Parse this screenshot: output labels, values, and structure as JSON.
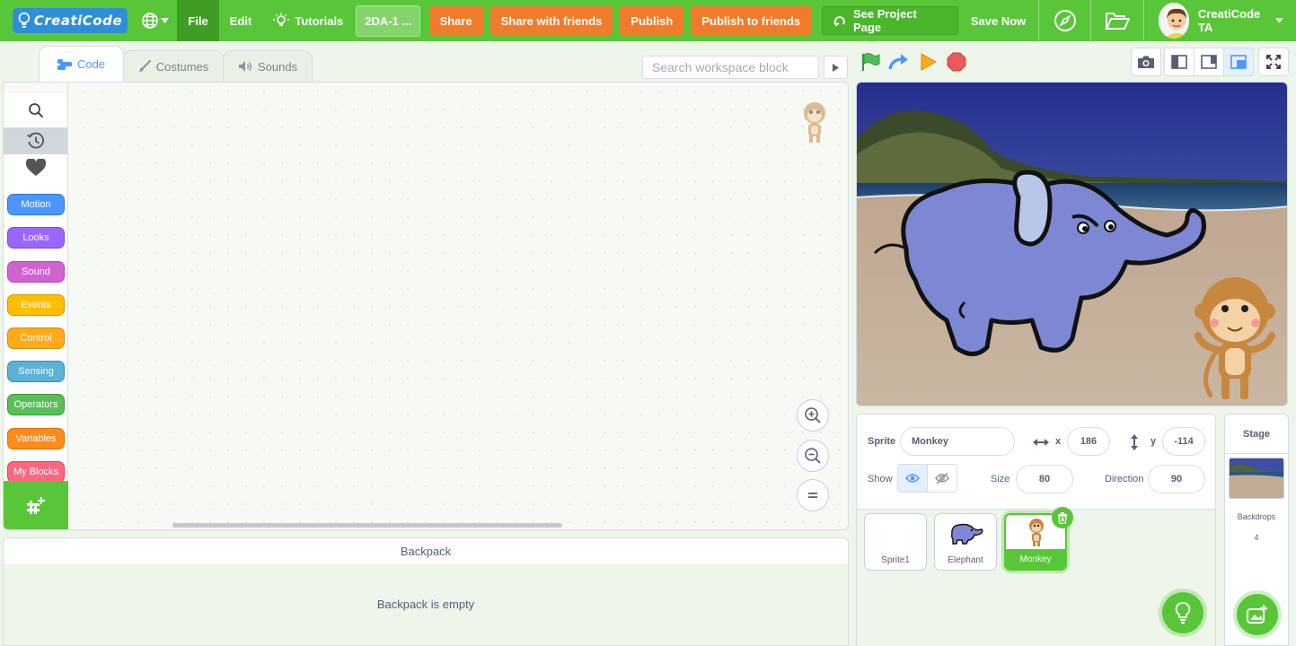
{
  "menu": {
    "logo_text": "CreatiCode",
    "file": "File",
    "edit": "Edit",
    "tutorials": "Tutorials",
    "project_title": "2DA-1 ...",
    "share": "Share",
    "share_friends": "Share with friends",
    "publish": "Publish",
    "publish_friends": "Publish to friends",
    "see_project": "See Project Page",
    "save_now": "Save Now",
    "user_name": "CreatiCode TA"
  },
  "tabs": {
    "code": "Code",
    "costumes": "Costumes",
    "sounds": "Sounds"
  },
  "workspace_search": {
    "placeholder": "Search workspace block"
  },
  "categories": [
    {
      "label": "Motion",
      "color": "#4c97ff",
      "border": "#3373cc"
    },
    {
      "label": "Looks",
      "color": "#9966ff",
      "border": "#774dcb"
    },
    {
      "label": "Sound",
      "color": "#cf63cf",
      "border": "#bd42bd"
    },
    {
      "label": "Events",
      "color": "#ffbf00",
      "border": "#cc9900"
    },
    {
      "label": "Control",
      "color": "#ffab19",
      "border": "#cf8b17"
    },
    {
      "label": "Sensing",
      "color": "#5cb1d6",
      "border": "#2e8eb8"
    },
    {
      "label": "Operators",
      "color": "#59c059",
      "border": "#389438"
    },
    {
      "label": "Variables",
      "color": "#ff8c1a",
      "border": "#db6e00"
    },
    {
      "label": "My Blocks",
      "color": "#ff6680",
      "border": "#ff3355"
    }
  ],
  "backpack": {
    "title": "Backpack",
    "empty": "Backpack is empty"
  },
  "sprite_info": {
    "sprite_label": "Sprite",
    "sprite_name": "Monkey",
    "x_label": "x",
    "x_value": "186",
    "y_label": "y",
    "y_value": "-114",
    "show_label": "Show",
    "size_label": "Size",
    "size_value": "80",
    "direction_label": "Direction",
    "direction_value": "90"
  },
  "sprites": [
    {
      "name": "Sprite1",
      "selected": false
    },
    {
      "name": "Elephant",
      "selected": false
    },
    {
      "name": "Monkey",
      "selected": true
    }
  ],
  "stage_target": {
    "title": "Stage",
    "backdrops_label": "Backdrops",
    "backdrops_count": "4"
  },
  "colors": {
    "brand_green": "#59c63a",
    "accent_orange": "#f07c2b",
    "accent_blue": "#4c97ff"
  }
}
